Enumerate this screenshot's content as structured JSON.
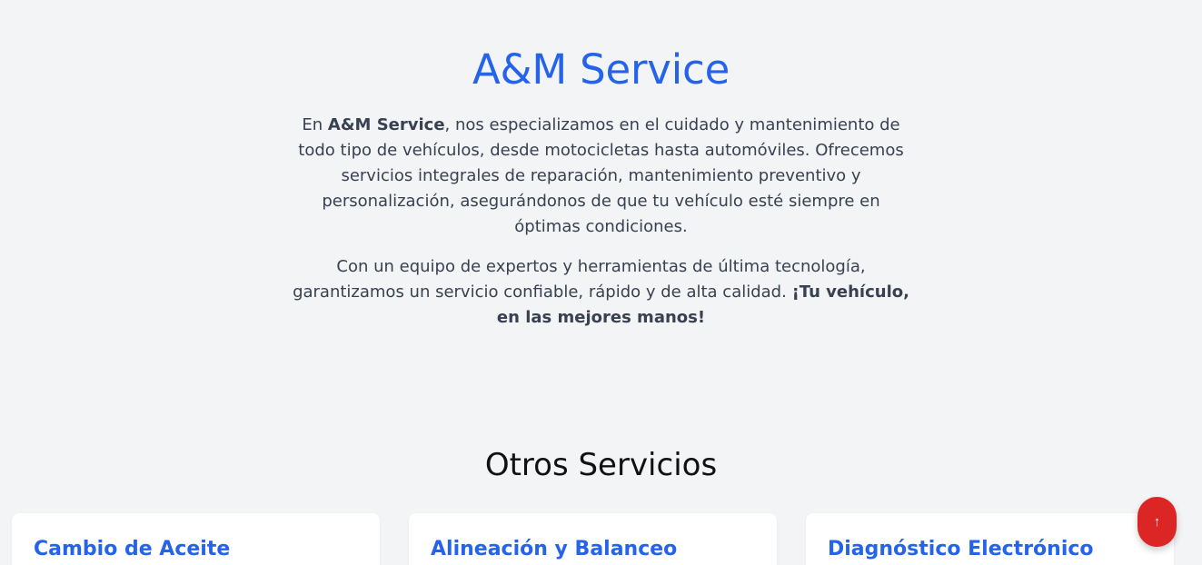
{
  "hero": {
    "title": "A&M Service",
    "p1_prefix": "En ",
    "p1_brand": "A&M Service",
    "p1_rest": ", nos especializamos en el cuidado y mantenimiento de todo tipo de vehículos, desde motocicletas hasta automóviles. Ofrecemos servicios integrales de reparación, mantenimiento preventivo y personalización, asegurándonos de que tu vehículo esté siempre en óptimas condiciones.",
    "p2_text": "Con un equipo de expertos y herramientas de última tecnología, garantizamos un servicio confiable, rápido y de alta calidad. ",
    "p2_strong": "¡Tu vehículo, en las mejores manos!"
  },
  "services": {
    "title": "Otros Servicios",
    "cards": [
      {
        "title": "Cambio de Aceite"
      },
      {
        "title": "Alineación y Balanceo"
      },
      {
        "title": "Diagnóstico Electrónico"
      }
    ]
  },
  "scroll_top": {
    "icon": "arrow-up-icon",
    "glyph": "↑",
    "color": "#dc2626"
  },
  "colors": {
    "accent": "#2563eb",
    "background": "#f3f4f6"
  }
}
